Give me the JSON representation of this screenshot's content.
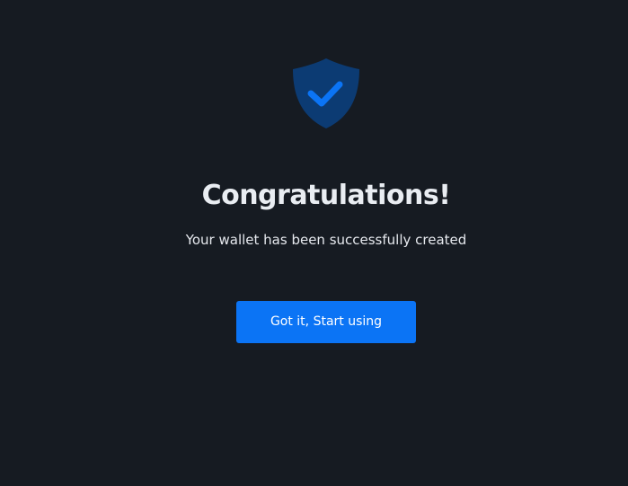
{
  "success": {
    "icon": "shield-check-icon",
    "title": "Congratulations!",
    "message": "Your wallet has been successfully created",
    "button_label": "Got it, Start using"
  },
  "colors": {
    "background": "#161b22",
    "shield": "#0c3b73",
    "check": "#0b74f5",
    "button": "#0b74f5",
    "title_text": "#e9edf2",
    "body_text": "#e6e9ee"
  }
}
